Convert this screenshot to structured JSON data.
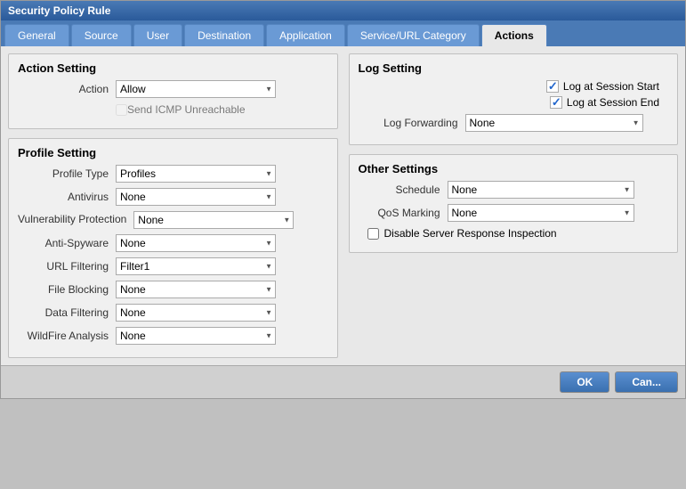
{
  "dialog": {
    "title": "Security Policy Rule"
  },
  "tabs": [
    {
      "id": "general",
      "label": "General",
      "active": false
    },
    {
      "id": "source",
      "label": "Source",
      "active": false
    },
    {
      "id": "user",
      "label": "User",
      "active": false
    },
    {
      "id": "destination",
      "label": "Destination",
      "active": false
    },
    {
      "id": "application",
      "label": "Application",
      "active": false
    },
    {
      "id": "service-url",
      "label": "Service/URL Category",
      "active": false
    },
    {
      "id": "actions",
      "label": "Actions",
      "active": true
    }
  ],
  "action_setting": {
    "title": "Action Setting",
    "action_label": "Action",
    "action_value": "Allow",
    "send_icmp_label": "Send ICMP Unreachable"
  },
  "profile_setting": {
    "title": "Profile Setting",
    "profile_type_label": "Profile Type",
    "profile_type_value": "Profiles",
    "antivirus_label": "Antivirus",
    "antivirus_value": "None",
    "vuln_label": "Vulnerability Protection",
    "vuln_value": "None",
    "anti_spyware_label": "Anti-Spyware",
    "anti_spyware_value": "None",
    "url_filtering_label": "URL Filtering",
    "url_filtering_value": "Filter1",
    "file_blocking_label": "File Blocking",
    "file_blocking_value": "None",
    "data_filtering_label": "Data Filtering",
    "data_filtering_value": "None",
    "wildfire_label": "WildFire Analysis",
    "wildfire_value": "None"
  },
  "log_setting": {
    "title": "Log Setting",
    "log_session_start_label": "Log at Session Start",
    "log_session_start_checked": true,
    "log_session_end_label": "Log at Session End",
    "log_session_end_checked": true,
    "log_forwarding_label": "Log Forwarding",
    "log_forwarding_value": "None"
  },
  "other_settings": {
    "title": "Other Settings",
    "schedule_label": "Schedule",
    "schedule_value": "None",
    "qos_label": "QoS Marking",
    "qos_value": "None",
    "disable_label": "Disable Server Response Inspection"
  },
  "footer": {
    "ok_label": "OK",
    "cancel_label": "Can..."
  }
}
